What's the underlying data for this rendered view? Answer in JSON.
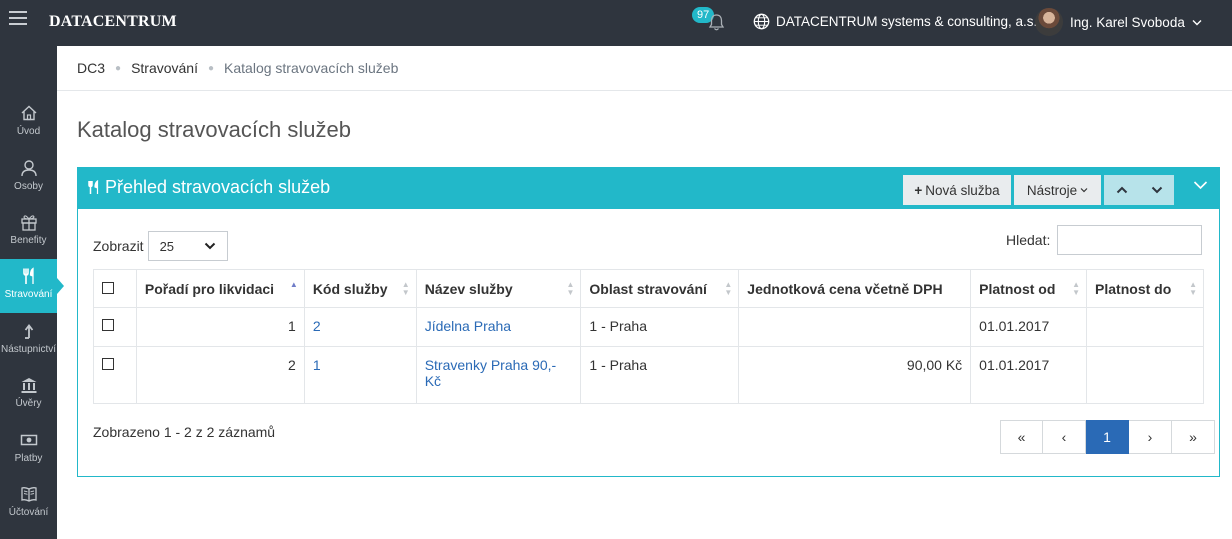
{
  "topbar": {
    "logo": "DATACENTRUM",
    "notifications_count": "97",
    "organization": "DATACENTRUM systems & consulting, a.s.",
    "user_name": "Ing. Karel Svoboda"
  },
  "sidebar": {
    "items": [
      {
        "label": "Úvod",
        "icon": "home-icon"
      },
      {
        "label": "Osoby",
        "icon": "person-icon"
      },
      {
        "label": "Benefity",
        "icon": "gift-icon"
      },
      {
        "label": "Stravování",
        "icon": "cutlery-icon",
        "active": true
      },
      {
        "label": "Nástupnictví",
        "icon": "succession-icon"
      },
      {
        "label": "Úvěry",
        "icon": "bank-icon"
      },
      {
        "label": "Platby",
        "icon": "money-icon"
      },
      {
        "label": "Účtování",
        "icon": "book-icon"
      }
    ]
  },
  "breadcrumb": [
    "DC3",
    "Stravování",
    "Katalog stravovacích služeb"
  ],
  "page_title": "Katalog stravovacích služeb",
  "panel": {
    "title": "Přehled stravovacích služeb",
    "new_button": "Nová služba",
    "tools_button": "Nástroje"
  },
  "table_controls": {
    "show_label": "Zobrazit",
    "page_size": "25",
    "search_label": "Hledat:",
    "search_value": ""
  },
  "table": {
    "columns": [
      "Pořadí pro likvidaci",
      "Kód služby",
      "Název služby",
      "Oblast stravování",
      "Jednotková cena včetně DPH",
      "Platnost od",
      "Platnost do"
    ],
    "rows": [
      {
        "order": "1",
        "code": "2",
        "name": "Jídelna Praha",
        "area": "1 - Praha",
        "price": "",
        "valid_from": "01.01.2017",
        "valid_to": ""
      },
      {
        "order": "2",
        "code": "1",
        "name": "Stravenky Praha 90,- Kč",
        "area": "1 - Praha",
        "price": "90,00 Kč",
        "valid_from": "01.01.2017",
        "valid_to": ""
      }
    ]
  },
  "footer": {
    "info": "Zobrazeno 1 - 2 z 2 záznamů",
    "pages": [
      "«",
      "‹",
      "1",
      "›",
      "»"
    ],
    "current_page": "1"
  },
  "colors": {
    "accent": "#22b8c9",
    "dark": "#2f353e",
    "link": "#2a6ab6"
  }
}
